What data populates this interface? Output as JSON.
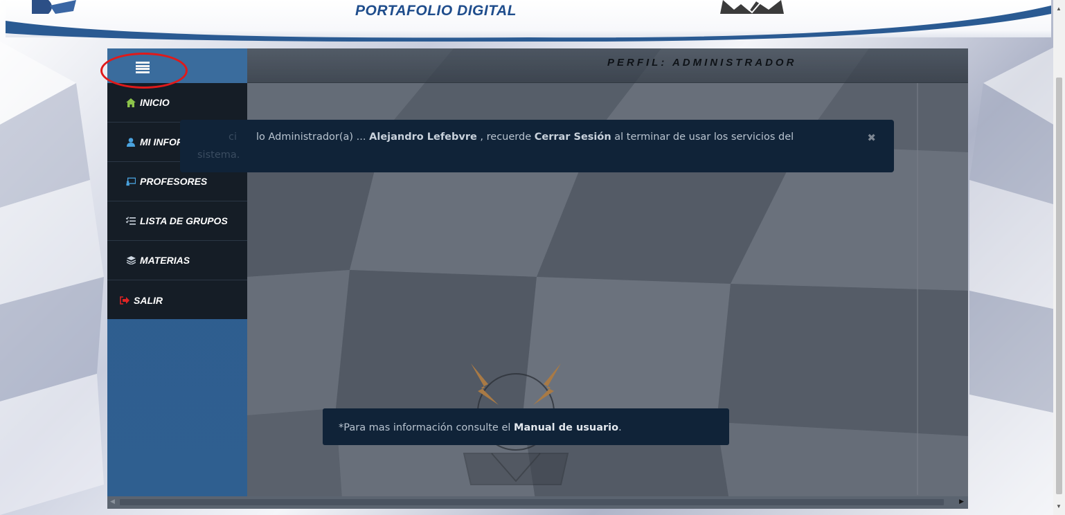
{
  "header": {
    "site_title": "PORTAFOLIO DIGITAL"
  },
  "panel": {
    "profile_title": "PERFIL: ADMINISTRADOR"
  },
  "sidebar": {
    "items": [
      {
        "label": "INICIO",
        "icon": "home-icon"
      },
      {
        "label": "MI INFORMACIÓN",
        "icon": "user-icon"
      },
      {
        "label": "PROFESORES",
        "icon": "chalkboard-teacher-icon"
      },
      {
        "label": "LISTA DE GRUPOS",
        "icon": "list-check-icon"
      },
      {
        "label": "MATERIAS",
        "icon": "layers-icon"
      },
      {
        "label": "SALIR",
        "icon": "sign-out-icon"
      }
    ]
  },
  "alert": {
    "prefix_hidden": "ci",
    "text_lead": "lo Administrador(a) ... ",
    "user_name": "Alejandro Lefebvre",
    "text_mid": " , recuerde ",
    "action": "Cerrar Sesión",
    "text_tail": " al terminar de usar los servicios del",
    "line2": "sistema.",
    "close_symbol": "✖"
  },
  "note": {
    "prefix": "*Para mas información consulte el ",
    "link": "Manual de usuario",
    "suffix": "."
  },
  "colors": {
    "accent_title": "#1f4d8c",
    "sidebar_blue": "#2e5d8e",
    "menu_dark": "#151d26",
    "alert_bg": "#102338",
    "annotation_red": "#e01a1a",
    "exit_red": "#e02424",
    "home_green": "#8bc34a"
  }
}
